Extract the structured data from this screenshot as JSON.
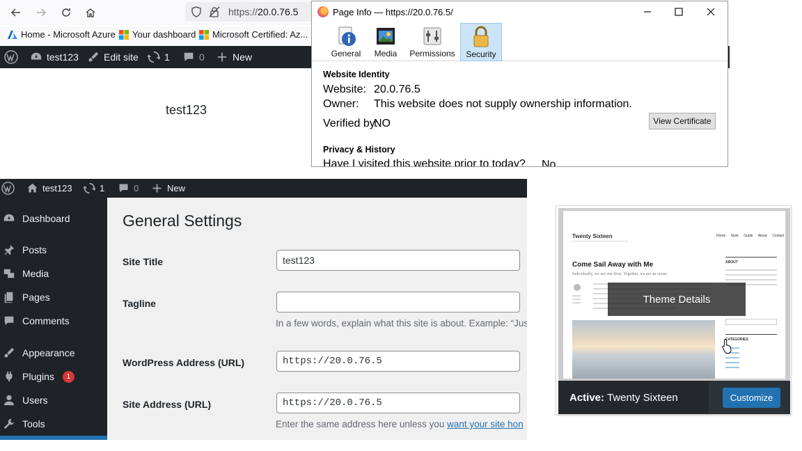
{
  "browser": {
    "url_prefix": "https://",
    "url_host": "20.0.76.5",
    "bookmarks": [
      {
        "label": "Home - Microsoft Azure"
      },
      {
        "label": "Your dashboard"
      },
      {
        "label": "Microsoft Certified: Az..."
      }
    ],
    "wp_toolbar": {
      "site_name": "test123",
      "edit_site": "Edit site",
      "updates_count": "1",
      "comments_count": "0",
      "new_label": "New"
    },
    "site_heading": "test123"
  },
  "page_info": {
    "title": "Page Info — https://20.0.76.5/",
    "tabs": [
      {
        "label": "General"
      },
      {
        "label": "Media"
      },
      {
        "label": "Permissions"
      },
      {
        "label": "Security"
      }
    ],
    "identity_heading": "Website Identity",
    "website_label": "Website:",
    "website_value": "20.0.76.5",
    "owner_label": "Owner:",
    "owner_value": "This website does not supply ownership information.",
    "verified_label": "Verified by:",
    "verified_value": "NO",
    "view_cert_label": "View Certificate",
    "privacy_heading": "Privacy & History",
    "visited_question": "Have I visited this website prior to today?",
    "visited_answer": "No"
  },
  "wp_admin": {
    "toolbar": {
      "site_name": "test123",
      "updates_count": "1",
      "comments_count": "0",
      "new_label": "New"
    },
    "menu": [
      {
        "label": "Dashboard"
      },
      {
        "label": "Posts"
      },
      {
        "label": "Media"
      },
      {
        "label": "Pages"
      },
      {
        "label": "Comments"
      },
      {
        "label": "Appearance"
      },
      {
        "label": "Plugins",
        "badge": "1"
      },
      {
        "label": "Users"
      },
      {
        "label": "Tools"
      }
    ],
    "page_title": "General Settings",
    "fields": {
      "site_title_label": "Site Title",
      "site_title_value": "test123",
      "tagline_label": "Tagline",
      "tagline_value": "",
      "tagline_desc": "In a few words, explain what this site is about. Example: “Jus",
      "wp_address_label": "WordPress Address (URL)",
      "wp_address_value": "https://20.0.76.5",
      "site_address_label": "Site Address (URL)",
      "site_address_value": "https://20.0.76.5",
      "site_address_desc": "Enter the same address here unless you ",
      "site_address_link": "want your site hon"
    }
  },
  "theme_card": {
    "preview": {
      "site_name": "Twenty Sixteen",
      "post_title": "Come Sail Away with Me",
      "post_subtitle": "Individually, we are one drop. Together, we are an ocean.",
      "nav_items": [
        "Home",
        "Style Guide",
        "About",
        "Contact"
      ],
      "widget_about": "ABOUT",
      "widget_categories": "CATEGORIES"
    },
    "details_label": "Theme Details",
    "active_prefix": "Active:",
    "active_theme": "Twenty Sixteen",
    "customize_label": "Customize",
    "colors": {
      "accent": "#2271b1",
      "bar": "#23282d"
    }
  }
}
